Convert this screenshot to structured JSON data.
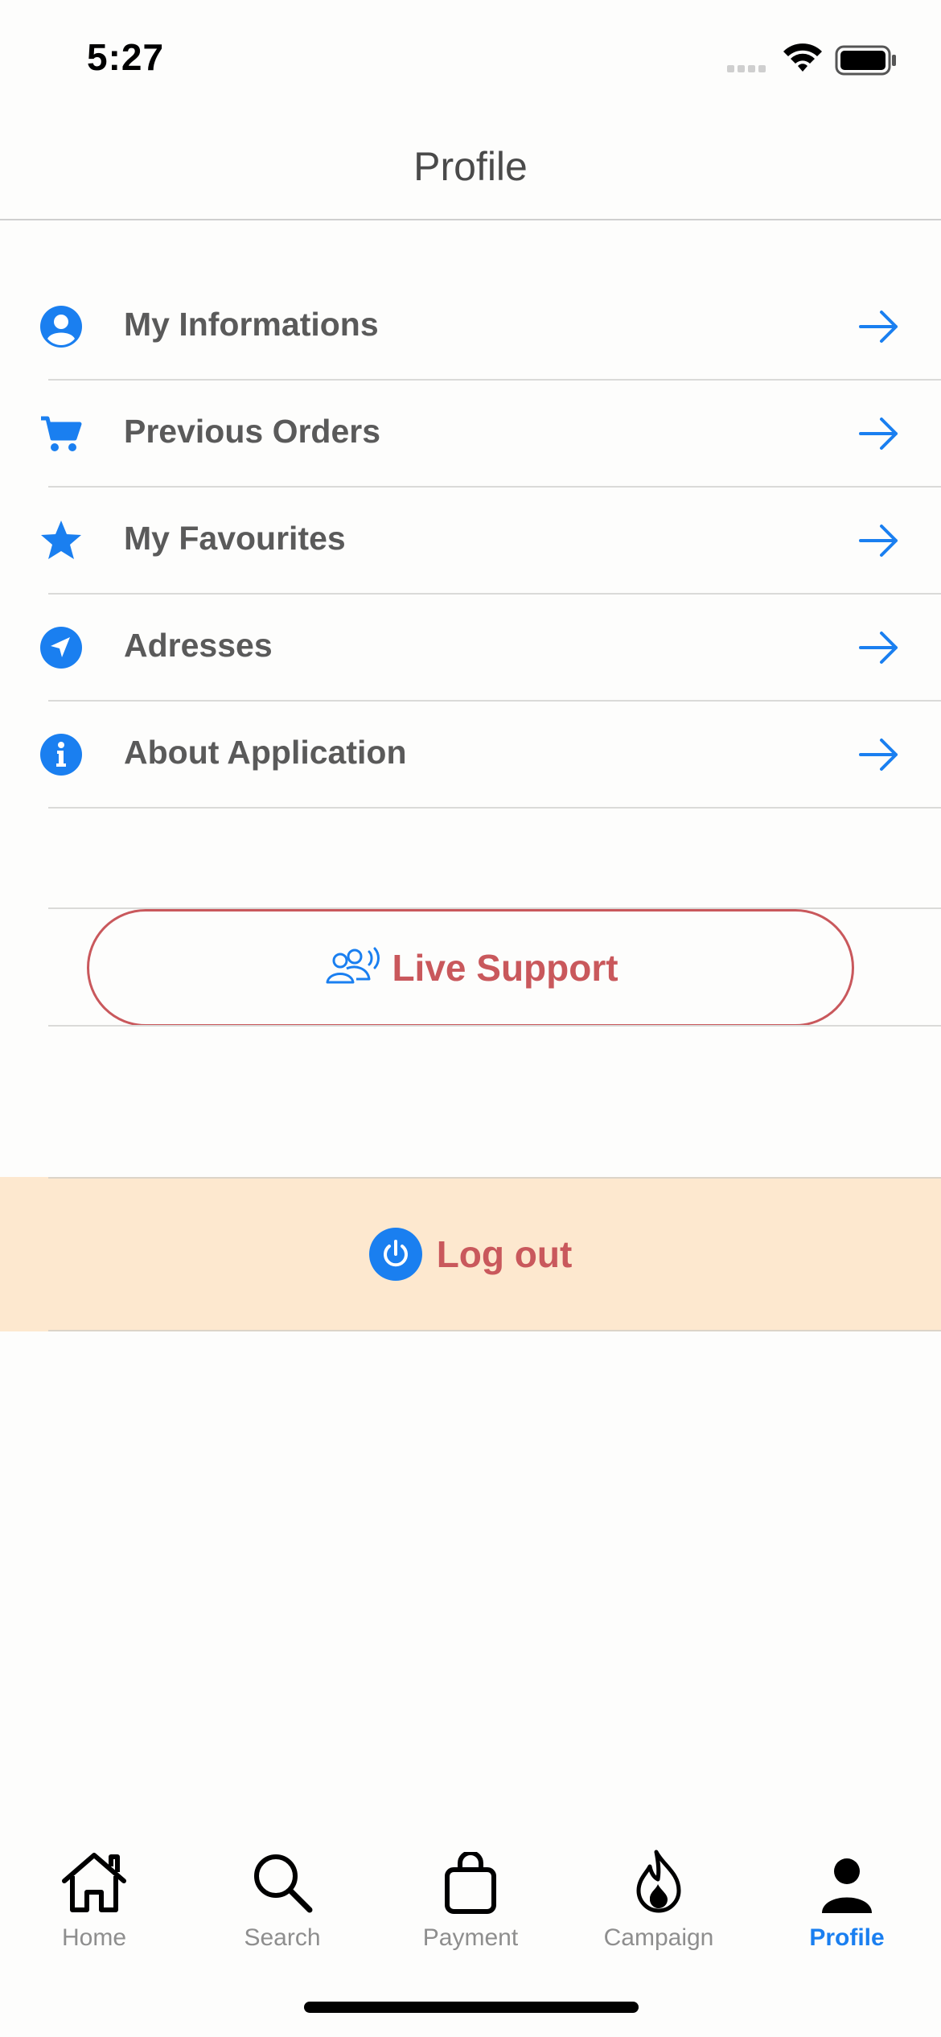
{
  "status_bar": {
    "time": "5:27",
    "icons": [
      "signal-icon",
      "wifi-icon",
      "battery-icon"
    ]
  },
  "header": {
    "title": "Profile"
  },
  "menu": {
    "items": [
      {
        "label": "My Informations",
        "icon": "user-circle-icon"
      },
      {
        "label": "Previous Orders",
        "icon": "cart-icon"
      },
      {
        "label": "My Favourites",
        "icon": "star-icon"
      },
      {
        "label": "Adresses",
        "icon": "location-arrow-icon"
      },
      {
        "label": "About Application",
        "icon": "info-icon"
      }
    ],
    "arrow_icon": "arrow-right-icon"
  },
  "support": {
    "label": "Live Support",
    "icon": "users-broadcast-icon"
  },
  "logout": {
    "label": "Log out",
    "icon": "power-icon"
  },
  "tab_bar": {
    "tabs": [
      {
        "label": "Home",
        "icon": "home-icon",
        "active": false
      },
      {
        "label": "Search",
        "icon": "search-icon",
        "active": false
      },
      {
        "label": "Payment",
        "icon": "bag-icon",
        "active": false
      },
      {
        "label": "Campaign",
        "icon": "flame-icon",
        "active": false
      },
      {
        "label": "Profile",
        "icon": "person-icon",
        "active": true
      }
    ]
  },
  "colors": {
    "accent": "#1a7ff0",
    "danger_text": "#c9585c",
    "logout_background": "#fde8cf",
    "label_text": "#5a5a5a",
    "background": "#fdfdfc"
  }
}
